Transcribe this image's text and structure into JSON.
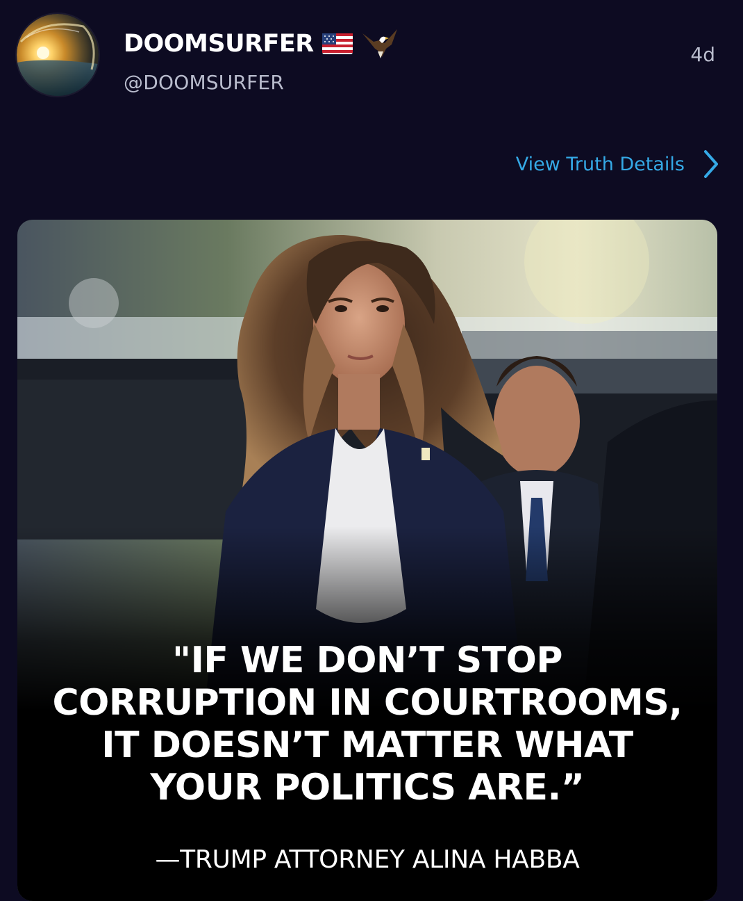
{
  "post": {
    "display_name": "DOOMSURFER",
    "badges": [
      "us-flag-icon",
      "eagle-icon"
    ],
    "handle": "@DOOMSURFER",
    "timestamp": "4d",
    "details_link": "View Truth Details"
  },
  "media": {
    "quote_lines": [
      "\"IF WE DON’T STOP",
      "CORRUPTION IN COURTROOMS,",
      "IT DOESN’T MATTER WHAT",
      "YOUR POLITICS ARE.”"
    ],
    "attribution": "—TRUMP ATTORNEY ALINA HABBA"
  },
  "colors": {
    "background": "#0d0b22",
    "link": "#35a9e6",
    "secondary_text": "#b9bccd",
    "primary_text": "#ffffff"
  }
}
